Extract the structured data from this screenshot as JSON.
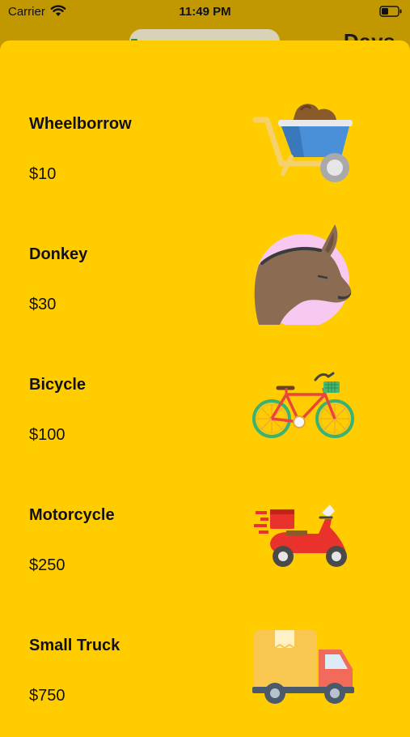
{
  "status_bar": {
    "carrier": "Carrier",
    "time": "11:49 PM"
  },
  "background": {
    "title": "Days"
  },
  "items": [
    {
      "name": "Wheelborrow",
      "price": "$10",
      "icon": "wheelbarrow-icon"
    },
    {
      "name": "Donkey",
      "price": "$30",
      "icon": "donkey-icon"
    },
    {
      "name": "Bicycle",
      "price": "$100",
      "icon": "bicycle-icon"
    },
    {
      "name": "Motorcycle",
      "price": "$250",
      "icon": "motorcycle-icon"
    },
    {
      "name": "Small Truck",
      "price": "$750",
      "icon": "truck-icon"
    }
  ],
  "colors": {
    "sheet_background": "#FFCC00",
    "dimmed_background": "#C29800",
    "text": "#111111"
  }
}
